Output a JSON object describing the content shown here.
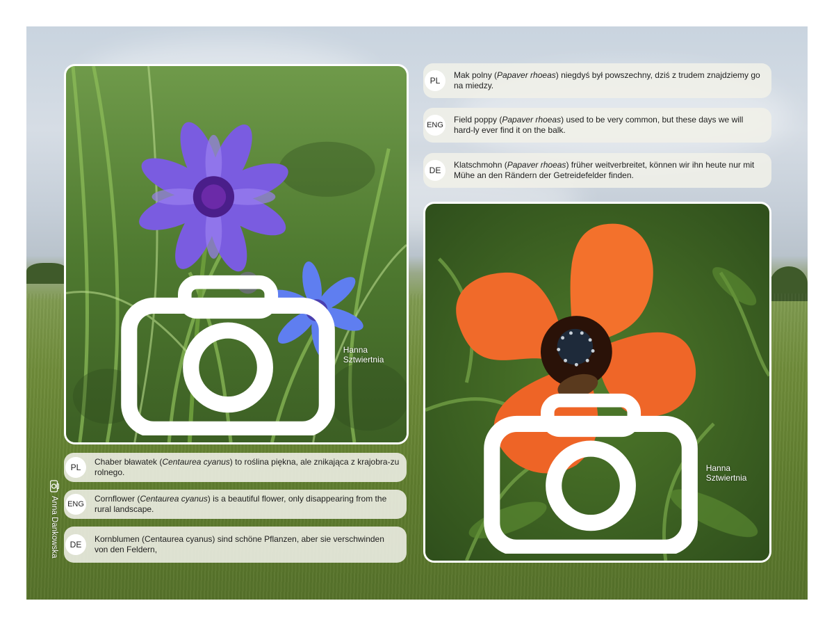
{
  "left_photo": {
    "subject": "cornflower",
    "credit": "Hanna Sztwiertnia"
  },
  "right_photo": {
    "subject": "poppy",
    "credit": "Hanna Sztwiertnia"
  },
  "side_credit": "Anna Dankowska",
  "cornflower_captions": [
    {
      "lang": "PL",
      "pre": "Chaber bławatek (",
      "latin": "Centaurea cyanus",
      "post": ") to roślina piękna, ale znikająca z krajobra-zu rolnego."
    },
    {
      "lang": "ENG",
      "pre": "Cornflower (",
      "latin": "Centaurea cyanus",
      "post": ") is a beautiful flower, only disappearing from the rural landscape."
    },
    {
      "lang": "DE",
      "pre": "Kornblumen (Centaurea cyanus) sind schöne Pflanzen, aber sie verschwinden von den Feldern,",
      "latin": "",
      "post": ""
    }
  ],
  "poppy_captions": [
    {
      "lang": "PL",
      "pre": "Mak polny (",
      "latin": "Papaver rhoeas",
      "post": ") niegdyś był powszechny, dziś z trudem znajdziemy go na miedzy."
    },
    {
      "lang": "ENG",
      "pre": "Field poppy (",
      "latin": "Papaver rhoeas",
      "post": ") used to be very common, but these days we will hard-ly ever find it on the balk."
    },
    {
      "lang": "DE",
      "pre": "Klatschmohn (",
      "latin": "Papaver rhoeas",
      "post": ") früher weitverbreitet, können wir ihn heute nur mit Mühe an den Rändern der Getreidefelder finden."
    }
  ],
  "icons": {
    "camera": "camera-icon"
  },
  "colors": {
    "caption_bg": "#f0f0e8",
    "border": "#ffffff",
    "cornflower": "#6a4fd8",
    "poppy": "#f06a2a"
  }
}
